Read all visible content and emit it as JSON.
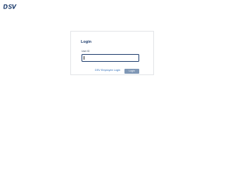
{
  "brand": {
    "logo_text": "DSV",
    "logo_color": "#1b3a6b"
  },
  "login": {
    "title": "Login",
    "user_id_label": "User ID",
    "user_id_value": "",
    "employee_link": "DSV Employee Login",
    "login_button": "Login"
  },
  "colors": {
    "title": "#1b3a6b",
    "input_border": "#1b3a6b",
    "link": "#2e6cb8",
    "button_bg": "#7f97b5",
    "button_text": "#ffffff",
    "card_border": "#e3e5e8"
  }
}
